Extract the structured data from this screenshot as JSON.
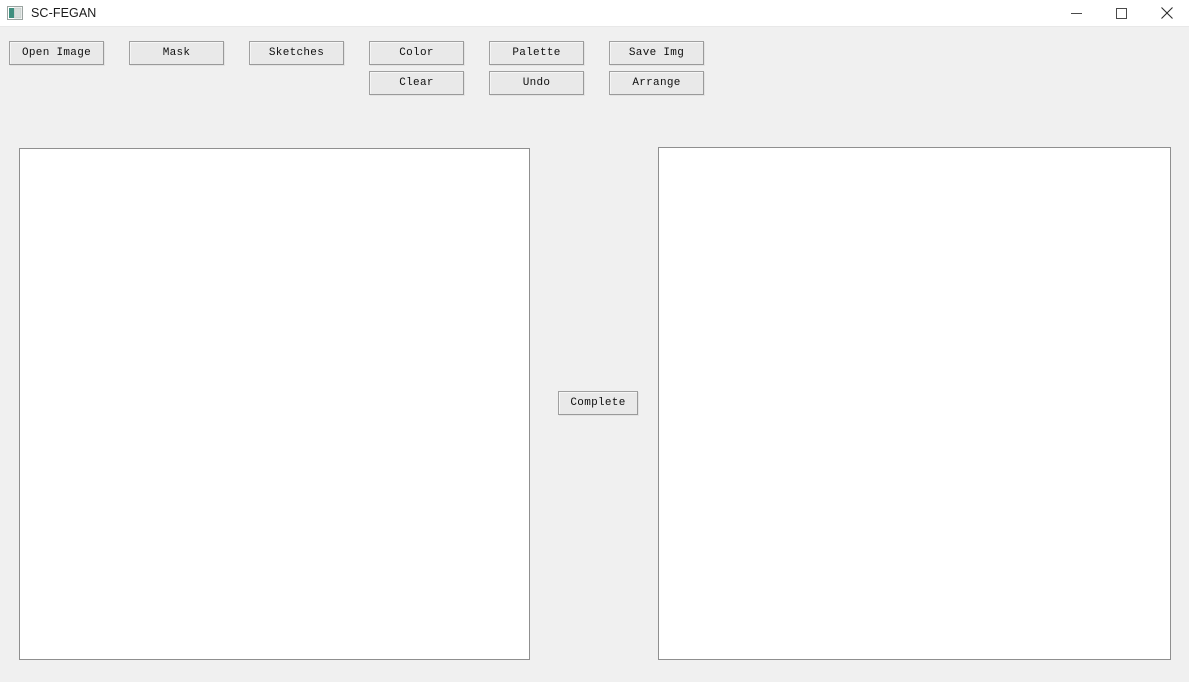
{
  "window": {
    "title": "SC-FEGAN",
    "icon": "image-picture-icon",
    "controls": {
      "minimize_label": "Minimize",
      "maximize_label": "Maximize",
      "close_label": "Close"
    }
  },
  "toolbar": {
    "row1": [
      {
        "id": "open-image",
        "label": "Open Image"
      },
      {
        "id": "mask",
        "label": "Mask"
      },
      {
        "id": "sketches",
        "label": "Sketches"
      },
      {
        "id": "color",
        "label": "Color"
      },
      {
        "id": "palette",
        "label": "Palette"
      },
      {
        "id": "save-img",
        "label": "Save Img"
      }
    ],
    "row2": [
      {
        "id": "clear",
        "label": "Clear"
      },
      {
        "id": "undo",
        "label": "Undo"
      },
      {
        "id": "arrange",
        "label": "Arrange"
      }
    ]
  },
  "main": {
    "complete_label": "Complete",
    "input_canvas": {
      "name": "input-canvas",
      "content": ""
    },
    "output_canvas": {
      "name": "output-canvas",
      "content": ""
    }
  },
  "colors": {
    "app_background": "#f0f0f0",
    "titlebar_background": "#ffffff",
    "button_face": "#e9e9e9",
    "button_border": "#a0a0a0",
    "canvas_background": "#ffffff",
    "canvas_border": "#8f8f8f",
    "text": "#101010",
    "icon_accent": "#3f8f7f"
  }
}
